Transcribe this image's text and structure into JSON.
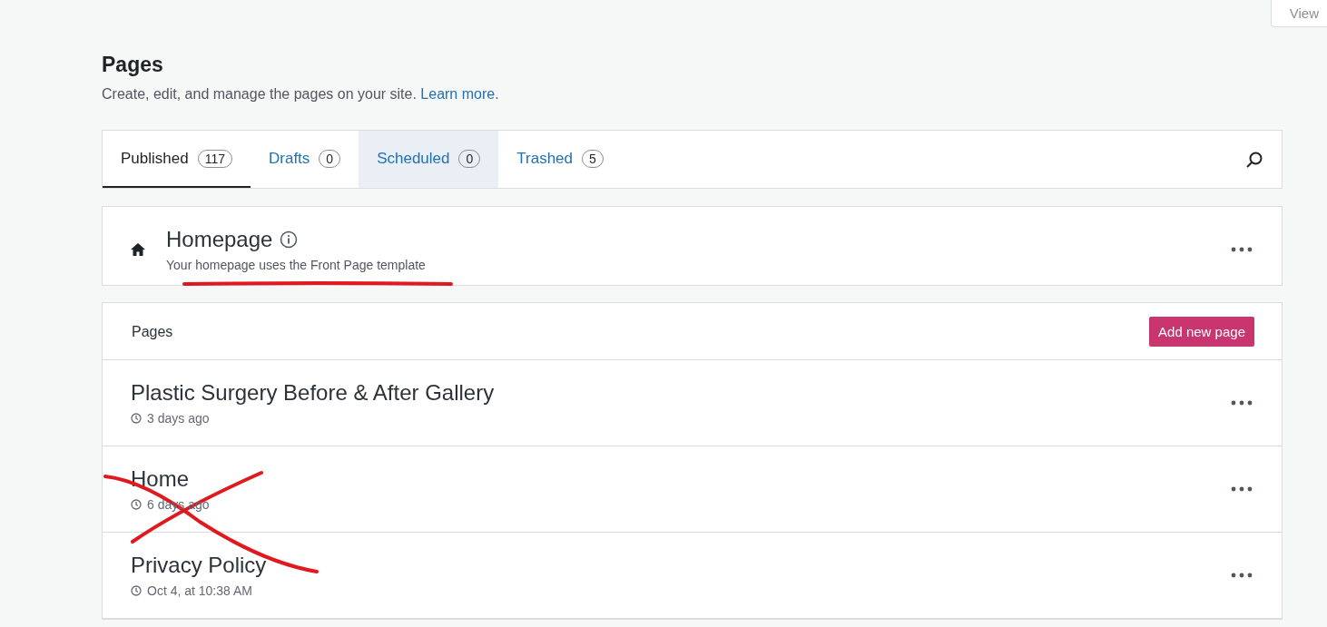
{
  "view_button": {
    "label": "View"
  },
  "header": {
    "title": "Pages",
    "subtitle": "Create, edit, and manage the pages on your site.",
    "link": "Learn more",
    "after_link": "."
  },
  "tabs": [
    {
      "label": "Published",
      "count": "117",
      "selected": true,
      "hovered": false
    },
    {
      "label": "Drafts",
      "count": "0",
      "selected": false,
      "hovered": false
    },
    {
      "label": "Scheduled",
      "count": "0",
      "selected": false,
      "hovered": true
    },
    {
      "label": "Trashed",
      "count": "5",
      "selected": false,
      "hovered": false
    }
  ],
  "homepage_card": {
    "title": "Homepage",
    "description": "Your homepage uses the Front Page template"
  },
  "pages_list": {
    "heading": "Pages",
    "add_button": "Add new page",
    "rows": [
      {
        "title": "Plastic Surgery Before & After Gallery",
        "date": "3 days ago"
      },
      {
        "title": "Home",
        "date": "6 days ago"
      },
      {
        "title": "Privacy Policy",
        "date": "Oct 4, at 10:38 AM"
      }
    ]
  }
}
